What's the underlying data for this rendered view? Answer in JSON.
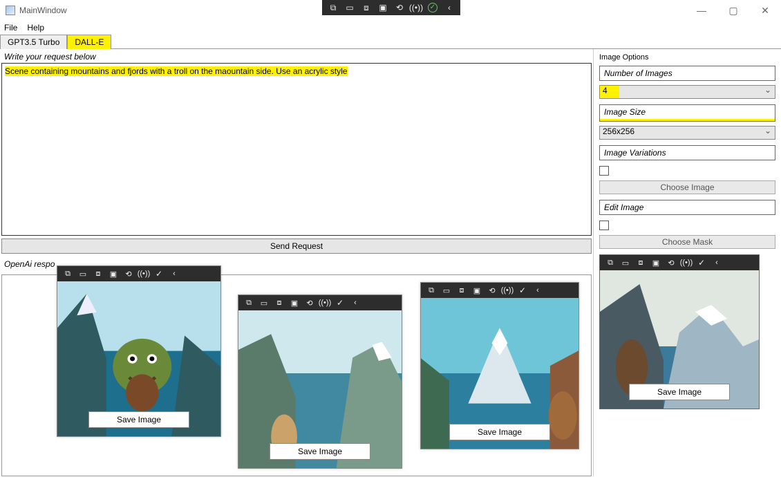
{
  "window": {
    "title": "MainWindow"
  },
  "menu": {
    "file": "File",
    "help": "Help"
  },
  "tabs": {
    "gpt": "GPT3.5 Turbo",
    "dalle": "DALL-E"
  },
  "prompt": {
    "label": "Write your request below",
    "text": "Scene containing mountains and fjords with a troll on the maountain side. Use an acrylic style"
  },
  "buttons": {
    "send": "Send Request",
    "save_image": "Save Image",
    "choose_image": "Choose Image",
    "choose_mask": "Choose Mask"
  },
  "response": {
    "label": "OpenAi respo"
  },
  "options": {
    "title": "Image Options",
    "num_label": "Number of Images",
    "num_value": "4",
    "size_label": "Image Size",
    "size_value": "256x256",
    "variations_label": "Image Variations",
    "edit_label": "Edit Image"
  }
}
